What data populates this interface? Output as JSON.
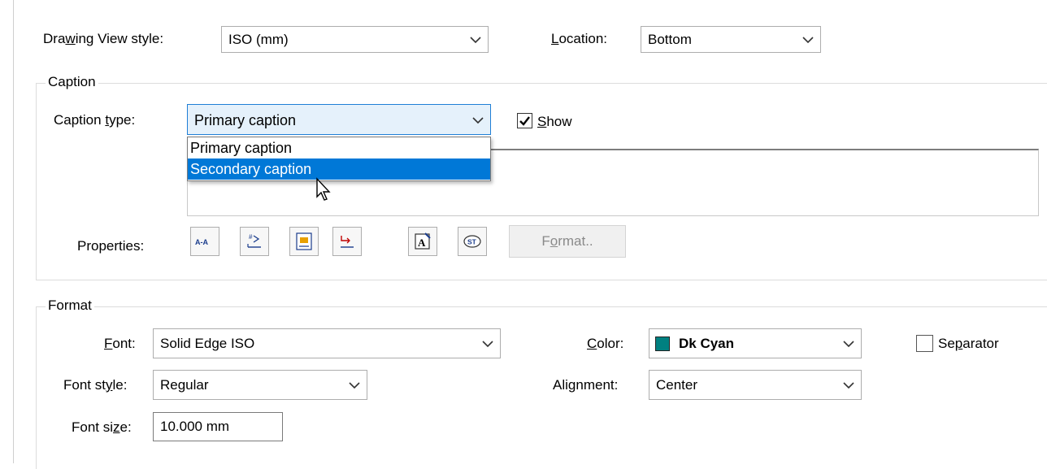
{
  "top": {
    "view_style_label_pre": "Dra",
    "view_style_label_u": "w",
    "view_style_label_post": "ing View style:",
    "view_style_value": "ISO (mm)",
    "location_label_u": "L",
    "location_label_post": "ocation:",
    "location_value": "Bottom"
  },
  "caption": {
    "group_title": "Caption",
    "type_label_pre": "Caption ",
    "type_label_u": "t",
    "type_label_post": "ype:",
    "type_value": "Primary caption",
    "dropdown_options": [
      "Primary caption",
      "Secondary caption"
    ],
    "show_label_u": "S",
    "show_label_post": "how",
    "show_checked": true,
    "properties_label": "Properties:",
    "format_button_pre": "F",
    "format_button_u": "o",
    "format_button_post": "rmat..",
    "icons": [
      "label-aa-icon",
      "insert-number-icon",
      "insert-property-icon",
      "insert-scale-icon",
      "text-format-icon",
      "symbol-st-icon"
    ]
  },
  "format": {
    "group_title": "Format",
    "font_label_u": "F",
    "font_label_post": "ont:",
    "font_value": "Solid Edge ISO",
    "color_label_u": "C",
    "color_label_post": "olor:",
    "color_value": "Dk Cyan",
    "color_swatch": "#008080",
    "separator_label_pre": "Se",
    "separator_label_u": "p",
    "separator_label_post": "arator",
    "font_style_label_pre": "Font st",
    "font_style_label_u": "y",
    "font_style_label_post": "le:",
    "font_style_value": "Regular",
    "alignment_label_pre": "Ali",
    "alignment_label_u": "g",
    "alignment_label_post": "nment:",
    "alignment_value": "Center",
    "font_size_label_pre": "Font si",
    "font_size_label_u": "z",
    "font_size_label_post": "e:",
    "font_size_value": "10.000 mm"
  }
}
